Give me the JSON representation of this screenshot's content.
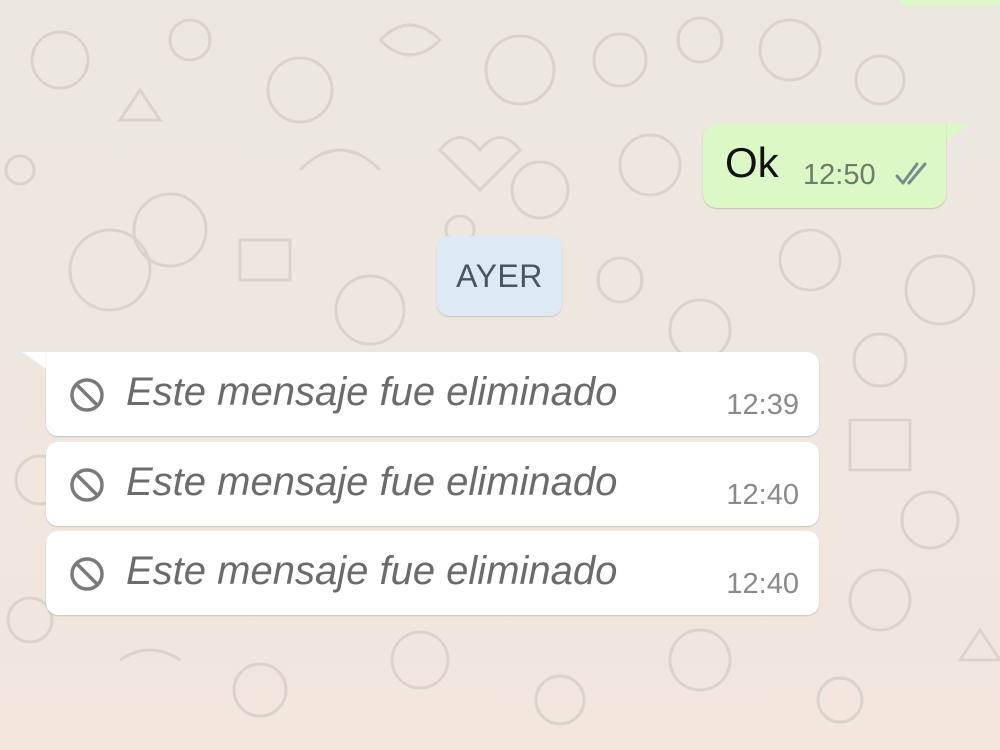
{
  "outgoing": {
    "text": "Ok",
    "time": "12:50",
    "status_icon": "double-check-icon"
  },
  "date_divider": {
    "label": "AYER"
  },
  "deleted_messages": [
    {
      "text": "Este mensaje fue eliminado",
      "time": "12:39",
      "icon": "ban-icon"
    },
    {
      "text": "Este mensaje fue eliminado",
      "time": "12:40",
      "icon": "ban-icon"
    },
    {
      "text": "Este mensaje fue eliminado",
      "time": "12:40",
      "icon": "ban-icon"
    }
  ],
  "colors": {
    "outgoing_bubble": "#dcf8c6",
    "incoming_bubble": "#ffffff",
    "date_chip": "#dbeaf5",
    "chat_background": "#ece5dd"
  }
}
